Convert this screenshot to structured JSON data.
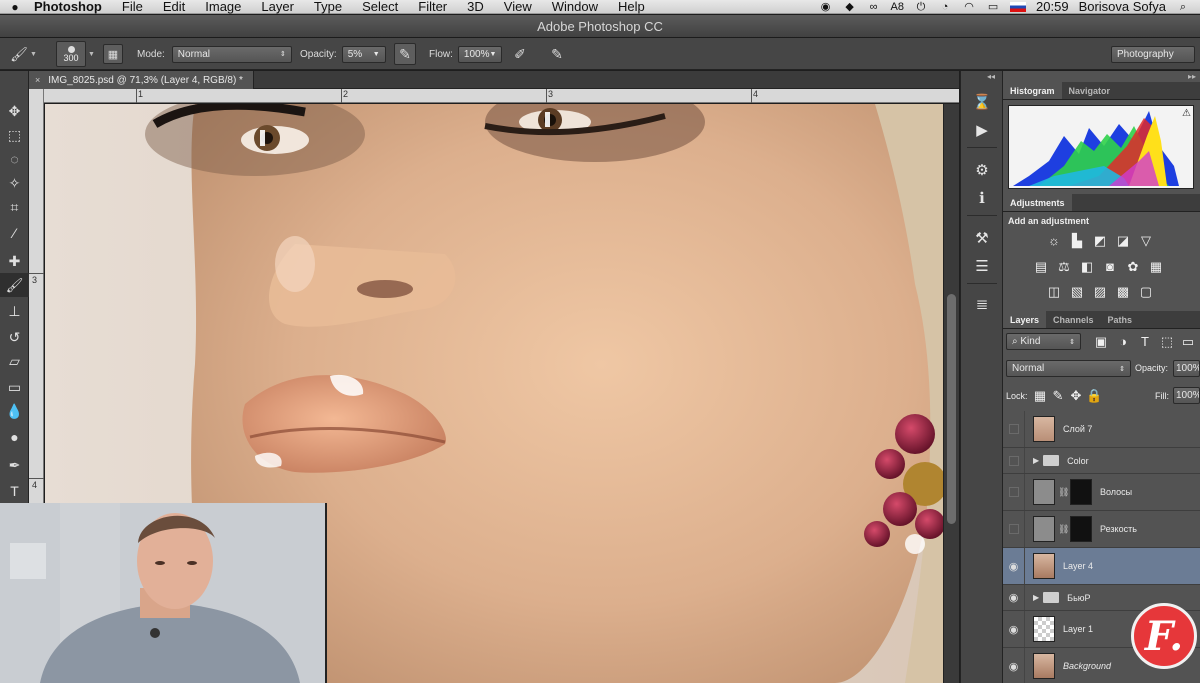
{
  "menubar": {
    "app_name": "Photoshop",
    "items": [
      "File",
      "Edit",
      "Image",
      "Layer",
      "Type",
      "Select",
      "Filter",
      "3D",
      "View",
      "Window",
      "Help"
    ],
    "ai_badge": "8",
    "clock": "20:59",
    "user": "Borisova Sofya"
  },
  "window": {
    "title": "Adobe Photoshop CC"
  },
  "options": {
    "brush_size": "300",
    "mode_label": "Mode:",
    "mode_value": "Normal",
    "opacity_label": "Opacity:",
    "opacity_value": "5%",
    "flow_label": "Flow:",
    "flow_value": "100%",
    "workspace": "Photography"
  },
  "document": {
    "tab_title": "IMG_8025.psd @ 71,3% (Layer 4, RGB/8) *",
    "ruler_h": [
      "1",
      "2",
      "3",
      "4"
    ],
    "ruler_v": [
      "3",
      "4"
    ]
  },
  "panels": {
    "top_tabs": [
      "Histogram",
      "Navigator"
    ],
    "adjustments": {
      "tab": "Adjustments",
      "subtitle": "Add an adjustment"
    },
    "layers": {
      "tabs": [
        "Layers",
        "Channels",
        "Paths"
      ],
      "filter_kind": "Kind",
      "blend_mode": "Normal",
      "opacity_label": "Opacity:",
      "opacity_value": "100%",
      "lock_label": "Lock:",
      "fill_label": "Fill:",
      "fill_value": "100%",
      "rows": [
        {
          "name": "Слой 7",
          "visible": false,
          "kind": "pixel"
        },
        {
          "name": "Color",
          "visible": false,
          "kind": "group"
        },
        {
          "name": "Волосы",
          "visible": false,
          "kind": "masked"
        },
        {
          "name": "Резкость",
          "visible": false,
          "kind": "masked"
        },
        {
          "name": "Layer 4",
          "visible": true,
          "kind": "pixel",
          "selected": true
        },
        {
          "name": "БьюР",
          "visible": true,
          "kind": "group"
        },
        {
          "name": "Layer 1",
          "visible": true,
          "kind": "pixel"
        },
        {
          "name": "Background",
          "visible": true,
          "kind": "pixel"
        }
      ]
    }
  },
  "logo": {
    "letter": "F."
  },
  "colors": {
    "selected_layer": "#6b7c95",
    "panel_bg": "#535353",
    "logo_red": "#e6373a"
  }
}
